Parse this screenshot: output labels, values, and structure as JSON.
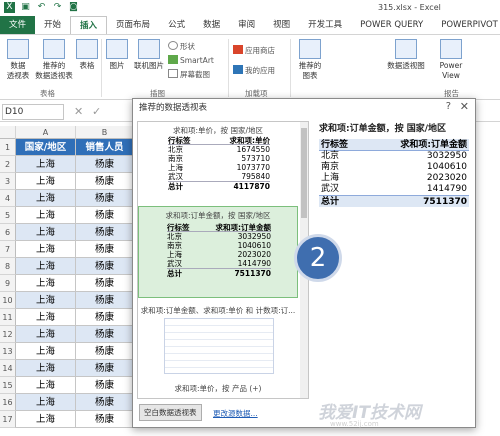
{
  "window": {
    "title": "315.xlsx - Excel"
  },
  "ribbon_tabs": [
    "文件",
    "开始",
    "插入",
    "页面布局",
    "公式",
    "数据",
    "审阅",
    "视图",
    "开发工具",
    "POWER QUERY",
    "POWERPIVOT"
  ],
  "ribbon": {
    "pivot_table": "数据\n透视表",
    "recommended_pivot": "推荐的\n数据透视表",
    "table": "表格",
    "picture": "图片",
    "online_picture": "联机图片",
    "shapes": "形状",
    "smartart": "SmartArt",
    "screenshot": "屏幕截图",
    "app_store": "应用商店",
    "my_apps": "我的应用",
    "recommended_chart": "推荐的\n图表",
    "pivot_chart": "数据透视图",
    "power_view": "Power\nView",
    "group_tables": "表格",
    "group_illustrations": "插图",
    "group_addins": "加载项",
    "group_report": "报告"
  },
  "formula_bar": {
    "name_box": "D10",
    "cancel": "✕",
    "enter": "✓",
    "fx": "fx"
  },
  "columns": [
    "A",
    "B"
  ],
  "header_row": [
    "国家/地区",
    "销售人员"
  ],
  "rows": [
    [
      "上海",
      "杨康"
    ],
    [
      "上海",
      "杨康"
    ],
    [
      "上海",
      "杨康"
    ],
    [
      "上海",
      "杨康"
    ],
    [
      "上海",
      "杨康"
    ],
    [
      "上海",
      "杨康"
    ],
    [
      "上海",
      "杨康"
    ],
    [
      "上海",
      "杨康"
    ],
    [
      "上海",
      "杨康"
    ],
    [
      "上海",
      "杨康"
    ],
    [
      "上海",
      "杨康"
    ],
    [
      "上海",
      "杨康"
    ],
    [
      "上海",
      "杨康"
    ],
    [
      "上海",
      "杨康"
    ],
    [
      "上海",
      "杨康"
    ],
    [
      "上海",
      "杨康"
    ]
  ],
  "row_numbers": [
    "1",
    "2",
    "3",
    "4",
    "5",
    "6",
    "7",
    "8",
    "9",
    "10",
    "11",
    "12",
    "13",
    "14",
    "15",
    "16",
    "17"
  ],
  "dialog": {
    "title": "推荐的数据透视表",
    "help": "?",
    "close": "✕",
    "card1": {
      "label": "求和项:单价，按 国家/地区",
      "header": [
        "行标签",
        "求和项:单价"
      ],
      "rows": [
        [
          "北京",
          "1674550"
        ],
        [
          "南京",
          "573710"
        ],
        [
          "上海",
          "1073770"
        ],
        [
          "武汉",
          "795840"
        ]
      ],
      "total": [
        "总计",
        "4117870"
      ]
    },
    "card2": {
      "label": "求和项:订单金额，按 国家/地区",
      "header": [
        "行标签",
        "求和项:订单金额"
      ],
      "rows": [
        [
          "北京",
          "3032950"
        ],
        [
          "南京",
          "1040610"
        ],
        [
          "上海",
          "2023020"
        ],
        [
          "武汉",
          "1414790"
        ]
      ],
      "total": [
        "总计",
        "7511370"
      ]
    },
    "card3": {
      "label": "求和项:订单金额、求和项:单价 和 计数项:订..."
    },
    "card4": {
      "label": "求和项:单价，按 产品 (+)"
    },
    "preview": {
      "title": "求和项:订单金额，按 国家/地区",
      "header": [
        "行标签",
        "求和项:订单金额"
      ],
      "rows": [
        [
          "北京",
          "3032950"
        ],
        [
          "南京",
          "1040610"
        ],
        [
          "上海",
          "2023020"
        ],
        [
          "武汉",
          "1414790"
        ]
      ],
      "total": [
        "总计",
        "7511370"
      ]
    },
    "blank_pivot_button": "空白数据透视表",
    "change_source_link": "更改源数据..."
  },
  "step_badge": "2",
  "watermark": {
    "text": "我爱IT技术网",
    "sub": "www.52ij.com"
  }
}
